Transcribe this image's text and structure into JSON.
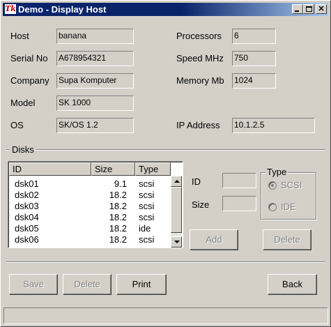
{
  "window": {
    "title": "Demo - Display Host",
    "app_icon": "Tk"
  },
  "host_fields": [
    {
      "label": "Host",
      "value": "banana"
    },
    {
      "label": "Serial No",
      "value": "A678954321"
    },
    {
      "label": "Company",
      "value": "Supa Komputer"
    },
    {
      "label": "Model",
      "value": "SK 1000"
    },
    {
      "label": "OS",
      "value": "SK/OS 1.2"
    }
  ],
  "spec_fields": [
    {
      "label": "Processors",
      "value": "6"
    },
    {
      "label": "Speed MHz",
      "value": "750"
    },
    {
      "label": "Memory Mb",
      "value": "1024"
    },
    {
      "label": "IP Address",
      "value": "10.1.2.5"
    }
  ],
  "disks": {
    "section_label": "Disks",
    "columns": [
      "ID",
      "Size",
      "Type"
    ],
    "rows": [
      {
        "id": "dsk01",
        "size": "9.1",
        "type": "scsi"
      },
      {
        "id": "dsk02",
        "size": "18.2",
        "type": "scsi"
      },
      {
        "id": "dsk03",
        "size": "18.2",
        "type": "scsi"
      },
      {
        "id": "dsk04",
        "size": "18.2",
        "type": "scsi"
      },
      {
        "id": "dsk05",
        "size": "18.2",
        "type": "ide"
      },
      {
        "id": "dsk06",
        "size": "18.2",
        "type": "scsi"
      }
    ],
    "edit": {
      "id_label": "ID",
      "id_value": "",
      "size_label": "Size",
      "size_value": "",
      "type_group_label": "Type",
      "type_options": [
        "SCSI",
        "IDE"
      ],
      "selected_type": "SCSI",
      "add_label": "Add",
      "delete_label": "Delete"
    }
  },
  "actions": {
    "save": "Save",
    "delete": "Delete",
    "print": "Print",
    "back": "Back"
  },
  "status_text": ""
}
